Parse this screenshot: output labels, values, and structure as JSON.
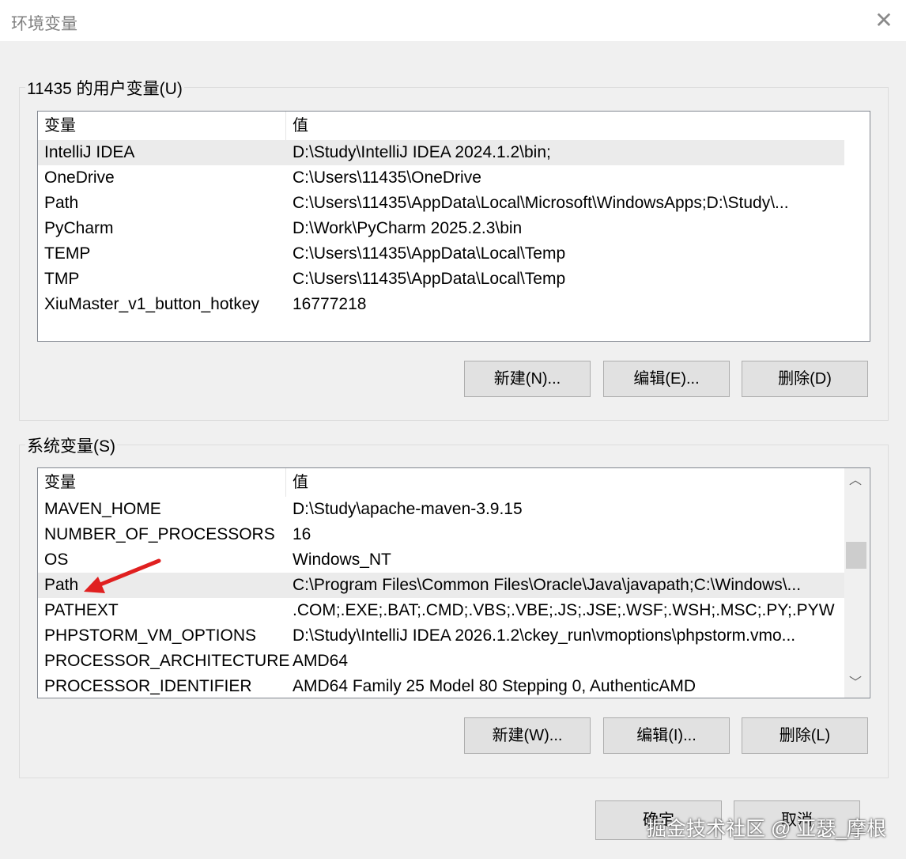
{
  "window": {
    "title": "环境变量",
    "close_icon": "close-icon"
  },
  "user_section": {
    "label": "11435 的用户变量(U)",
    "header": {
      "name": "变量",
      "value": "值"
    },
    "rows": [
      {
        "name": "IntelliJ IDEA",
        "value": "D:\\Study\\IntelliJ IDEA 2024.1.2\\bin;",
        "selected": true
      },
      {
        "name": "OneDrive",
        "value": "C:\\Users\\11435\\OneDrive"
      },
      {
        "name": "Path",
        "value": "C:\\Users\\11435\\AppData\\Local\\Microsoft\\WindowsApps;D:\\Study\\..."
      },
      {
        "name": "PyCharm",
        "value": "D:\\Work\\PyCharm 2025.2.3\\bin"
      },
      {
        "name": "TEMP",
        "value": "C:\\Users\\11435\\AppData\\Local\\Temp"
      },
      {
        "name": "TMP",
        "value": "C:\\Users\\11435\\AppData\\Local\\Temp"
      },
      {
        "name": "XiuMaster_v1_button_hotkey",
        "value": "16777218"
      }
    ],
    "buttons": {
      "new": "新建(N)...",
      "edit": "编辑(E)...",
      "delete": "删除(D)"
    }
  },
  "system_section": {
    "label": "系统变量(S)",
    "header": {
      "name": "变量",
      "value": "值"
    },
    "rows": [
      {
        "name": "MAVEN_HOME",
        "value": "D:\\Study\\apache-maven-3.9.15"
      },
      {
        "name": "NUMBER_OF_PROCESSORS",
        "value": "16"
      },
      {
        "name": "OS",
        "value": "Windows_NT"
      },
      {
        "name": "Path",
        "value": "C:\\Program Files\\Common Files\\Oracle\\Java\\javapath;C:\\Windows\\...",
        "selected": true
      },
      {
        "name": "PATHEXT",
        "value": ".COM;.EXE;.BAT;.CMD;.VBS;.VBE;.JS;.JSE;.WSF;.WSH;.MSC;.PY;.PYW"
      },
      {
        "name": "PHPSTORM_VM_OPTIONS",
        "value": "D:\\Study\\IntelliJ IDEA 2026.1.2\\ckey_run\\vmoptions\\phpstorm.vmo..."
      },
      {
        "name": "PROCESSOR_ARCHITECTURE",
        "value": "AMD64"
      },
      {
        "name": "PROCESSOR_IDENTIFIER",
        "value": "AMD64 Family 25 Model 80 Stepping 0, AuthenticAMD"
      }
    ],
    "buttons": {
      "new": "新建(W)...",
      "edit": "编辑(I)...",
      "delete": "删除(L)"
    },
    "scroll_up_icon": "chevron-up-icon",
    "scroll_down_icon": "chevron-down-icon"
  },
  "dialog_buttons": {
    "ok": "确定",
    "cancel": "取消"
  },
  "annotation": {
    "arrow_color": "#e02020",
    "arrow_icon": "arrow-icon"
  },
  "watermark": "掘金技术社区 @ 亚瑟_摩根"
}
